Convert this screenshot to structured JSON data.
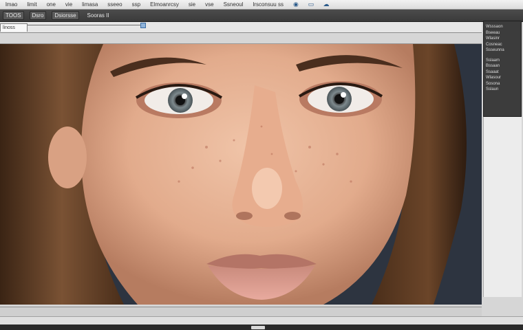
{
  "menubar": {
    "items": [
      "lmao",
      "limit",
      "one",
      "vie",
      "limasa",
      "sseeo",
      "ssp",
      "Elmoanrcsy",
      "sie",
      "vse",
      "Ssneoul",
      "lrsconsuu ss"
    ]
  },
  "toolbar": {
    "items": [
      "TOOS",
      "Dsro",
      "Dsiorsse",
      "Sooras II"
    ]
  },
  "tab": {
    "label": "linoss"
  },
  "panel": {
    "group1": [
      "Wsssaon",
      "Bseeau",
      "Wlasinr",
      "Cosneac",
      "Ssseunna"
    ],
    "group2": [
      "Sslaam",
      "Bssaan",
      "Ssaaat",
      "Wlasour",
      "Sosona",
      "Sslaun"
    ]
  },
  "colors": {
    "skin": "#e8b79c",
    "hair": "#5a3b24",
    "background": "#2d3440",
    "panel": "#3c3c3c"
  },
  "icons": [
    "eye-icon",
    "screen-icon",
    "cloud-icon"
  ]
}
